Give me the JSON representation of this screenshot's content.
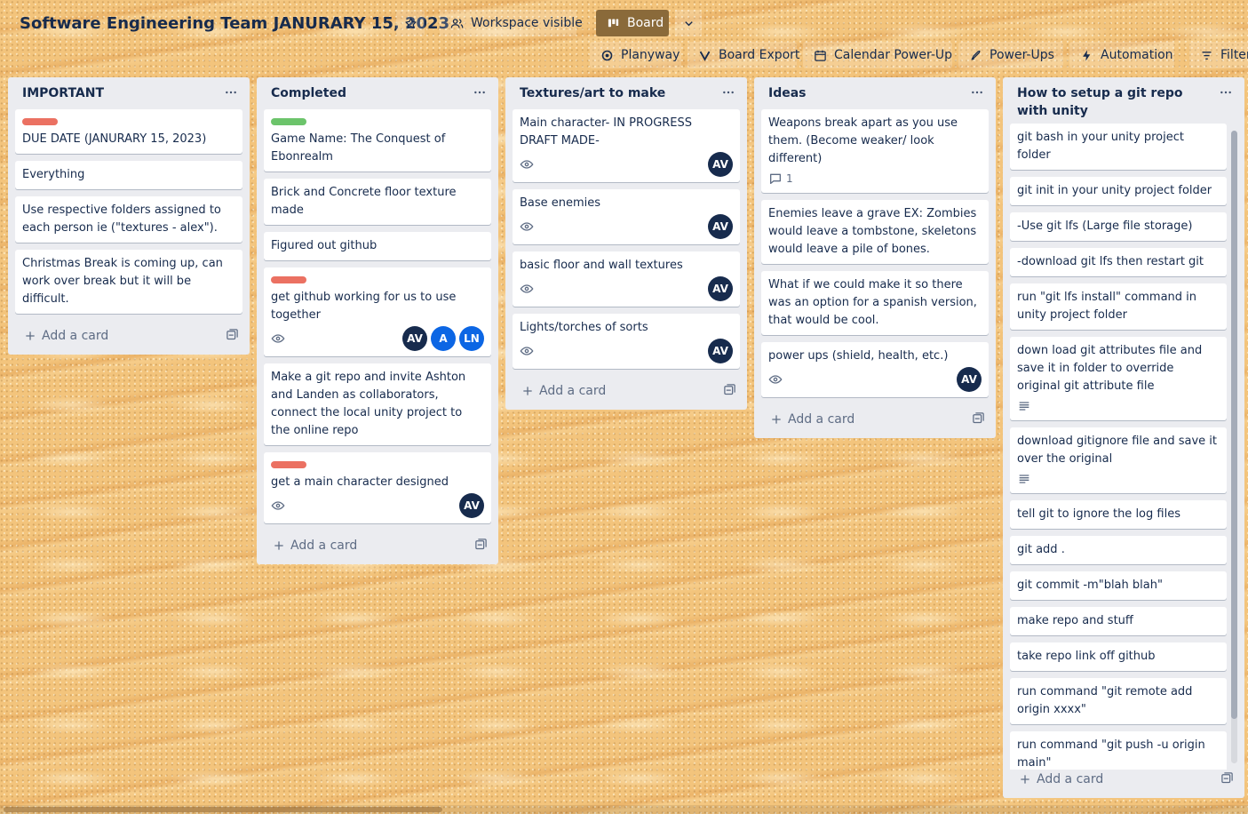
{
  "board": {
    "title": "Software Engineering Team JANURARY 15, 2023",
    "visibility": "Workspace visible",
    "view": "Board"
  },
  "powerups": {
    "planyway": "Planyway",
    "board_export": "Board Export",
    "calendar": "Calendar Power-Up",
    "power_ups": "Power-Ups",
    "automation": "Automation",
    "filter": "Filter"
  },
  "add_card_label": "Add a card",
  "lists": [
    {
      "title": "IMPORTANT",
      "cards": [
        {
          "label": "red",
          "text": "DUE DATE (JANURARY 15, 2023)"
        },
        {
          "text": "Everything"
        },
        {
          "text": "Use respective folders assigned to each person ie (\"textures - alex\")."
        },
        {
          "text": "Christmas Break is coming up, can work over break but it will be difficult."
        }
      ]
    },
    {
      "title": "Completed",
      "cards": [
        {
          "label": "green",
          "text": "Game Name: The Conquest of Ebonrealm"
        },
        {
          "text": "Brick and Concrete floor texture made"
        },
        {
          "text": "Figured out github"
        },
        {
          "label": "red",
          "text": "get github working for us to use together",
          "watch": true,
          "members": [
            "AV",
            "A",
            "LN"
          ]
        },
        {
          "text": "Make a git repo and invite Ashton and Landen as collaborators, connect the local unity project to the online repo"
        },
        {
          "label": "red",
          "text": "get a main character designed",
          "watch": true,
          "members": [
            "AV"
          ]
        }
      ]
    },
    {
      "title": "Textures/art to make",
      "cards": [
        {
          "text": "Main character- IN PROGRESS DRAFT MADE-",
          "watch": true,
          "members": [
            "AV"
          ]
        },
        {
          "text": "Base enemies",
          "watch": true,
          "members": [
            "AV"
          ]
        },
        {
          "text": "basic floor and wall textures",
          "watch": true,
          "members": [
            "AV"
          ]
        },
        {
          "text": "Lights/torches of sorts",
          "watch": true,
          "members": [
            "AV"
          ]
        }
      ]
    },
    {
      "title": "Ideas",
      "cards": [
        {
          "text": "Weapons break apart as you use them. (Become weaker/ look different)",
          "comments": "1"
        },
        {
          "text": "Enemies leave a grave EX: Zombies would leave a tombstone, skeletons would leave a pile of bones."
        },
        {
          "text": "What if we could make it so there was an option for a spanish version, that would be cool."
        },
        {
          "text": "power ups (shield, health, etc.)",
          "watch": true,
          "members": [
            "AV"
          ]
        }
      ]
    },
    {
      "title": "How to setup a git repo with unity",
      "cards": [
        {
          "text": "git bash in your unity project folder"
        },
        {
          "text": "git init in your unity project folder"
        },
        {
          "text": "-Use git lfs (Large file storage)"
        },
        {
          "text": "-download git lfs then restart git"
        },
        {
          "text": "run \"git lfs install\" command in unity project folder"
        },
        {
          "text": "down load git attributes file and save it in folder to override original git attribute file",
          "description": true
        },
        {
          "text": "download gitignore file and save it over the original",
          "description": true
        },
        {
          "text": "tell git to ignore the log files"
        },
        {
          "text": "git add ."
        },
        {
          "text": "git commit -m\"blah blah\""
        },
        {
          "text": "make repo and stuff"
        },
        {
          "text": "take repo link off github"
        },
        {
          "text": "run command \"git remote add origin xxxx\""
        },
        {
          "text": "run command \"git push -u origin main\""
        }
      ]
    }
  ]
}
